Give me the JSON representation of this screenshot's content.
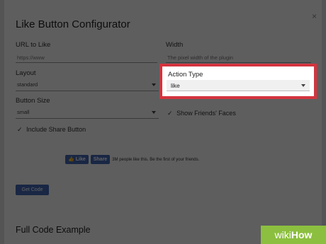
{
  "dialog": {
    "title": "Like Button Configurator",
    "close_glyph": "×",
    "url_label": "URL to Like",
    "url_placeholder": "https://www",
    "width_label": "Width",
    "width_placeholder": "The pixel width of the plugin",
    "layout_label": "Layout",
    "layout_value": "standard",
    "action_label": "Action Type",
    "action_value": "like",
    "size_label": "Button Size",
    "size_value": "small",
    "show_faces_label": "Show Friends' Faces",
    "share_label": "Include Share Button",
    "preview_like": "Like",
    "preview_share": "Share",
    "preview_text": "3M people like this. Be the first of your friends.",
    "get_code": "Get Code",
    "full_code_title": "Full Code Example"
  },
  "watermark": {
    "wiki": "wiki",
    "how": "How"
  },
  "colors": {
    "highlight": "#d3343e",
    "brand": "#4267b2",
    "watermark": "#8cbf3f"
  }
}
